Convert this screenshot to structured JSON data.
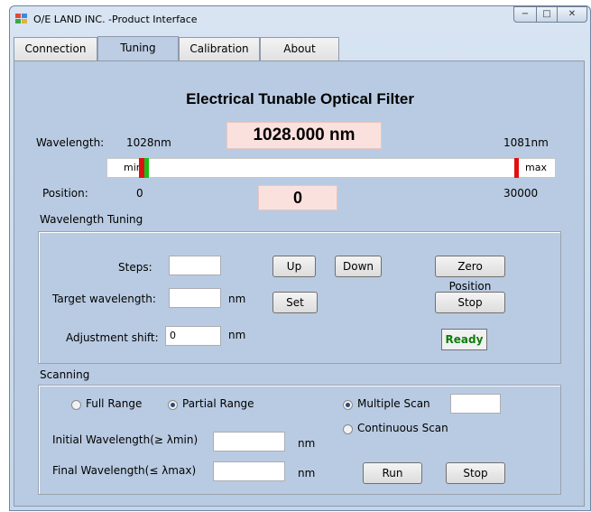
{
  "window": {
    "title": "O/E LAND INC. -Product Interface",
    "controls": {
      "minimize": "−",
      "maximize": "□",
      "close": "✕"
    }
  },
  "tabs": [
    {
      "label": "Connection",
      "active": false
    },
    {
      "label": "Tuning",
      "active": true
    },
    {
      "label": "Calibration",
      "active": false
    },
    {
      "label": "About",
      "active": false
    }
  ],
  "main": {
    "heading": "Electrical Tunable Optical Filter",
    "wavelength_label": "Wavelength:",
    "wavelength_min": "1028nm",
    "wavelength_display": "1028.000  nm",
    "wavelength_max": "1081nm",
    "slider": {
      "min_label": "min",
      "max_label": "max",
      "position_fraction": 0.0
    },
    "position_label": "Position:",
    "position_min": "0",
    "position_display": "0",
    "position_max": "30000"
  },
  "wavelength_tuning": {
    "title": "Wavelength Tuning",
    "steps_label": "Steps:",
    "steps_value": "",
    "target_label": "Target wavelength:",
    "target_value": "",
    "target_unit": "nm",
    "shift_label": "Adjustment shift:",
    "shift_value": "0",
    "shift_unit": "nm",
    "up_button": "Up",
    "down_button": "Down",
    "zero_button": "Zero Position",
    "set_button": "Set",
    "stop_button": "Stop",
    "status": "Ready"
  },
  "scanning": {
    "title": "Scanning",
    "full_range": "Full Range",
    "partial_range": "Partial Range",
    "multiple_scan": "Multiple  Scan",
    "multiple_value": "",
    "continuous_scan": "Continuous  Scan",
    "initial_label": "Initial  Wavelength(≥ λmin)",
    "initial_value": "",
    "initial_unit": "nm",
    "final_label": "Final  Wavelength(≤ λmax)",
    "final_value": "",
    "final_unit": "nm",
    "run_button": "Run",
    "stop_button": "Stop",
    "selected_range": "partial",
    "selected_mode": "multiple"
  },
  "colors": {
    "accent_red": "#e01010",
    "accent_green": "#18c018",
    "status_green": "#0b7d0b",
    "display_pink": "#fbe1dd"
  }
}
